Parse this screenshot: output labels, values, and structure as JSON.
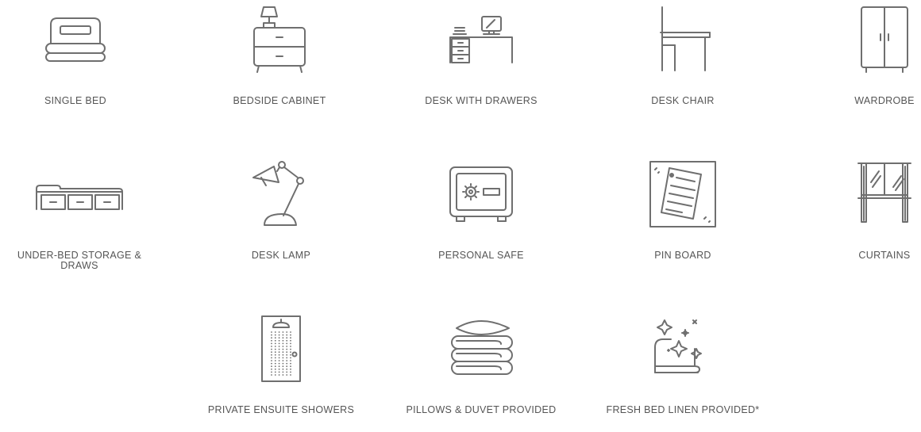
{
  "theme": {
    "icon_color": "#6f6f6f",
    "text_color": "#555555",
    "background": "#ffffff"
  },
  "amenities": [
    {
      "label": "SINGLE BED",
      "icon": "single-bed-icon"
    },
    {
      "label": "BEDSIDE CABINET",
      "icon": "bedside-cabinet-icon"
    },
    {
      "label": "DESK WITH DRAWERS",
      "icon": "desk-with-drawers-icon"
    },
    {
      "label": "DESK CHAIR",
      "icon": "desk-chair-icon"
    },
    {
      "label": "WARDROBE",
      "icon": "wardrobe-icon"
    },
    {
      "label": "UNDER-BED STORAGE & DRAWS",
      "icon": "under-bed-storage-icon"
    },
    {
      "label": "DESK LAMP",
      "icon": "desk-lamp-icon"
    },
    {
      "label": "PERSONAL SAFE",
      "icon": "personal-safe-icon"
    },
    {
      "label": "PIN BOARD",
      "icon": "pin-board-icon"
    },
    {
      "label": "CURTAINS",
      "icon": "curtains-icon"
    },
    {
      "label": "PRIVATE ENSUITE SHOWERS",
      "icon": "ensuite-shower-icon"
    },
    {
      "label": "PILLOWS & DUVET PROVIDED",
      "icon": "pillows-duvet-icon"
    },
    {
      "label": "FRESH BED LINEN PROVIDED*",
      "icon": "fresh-bed-linen-icon"
    }
  ]
}
